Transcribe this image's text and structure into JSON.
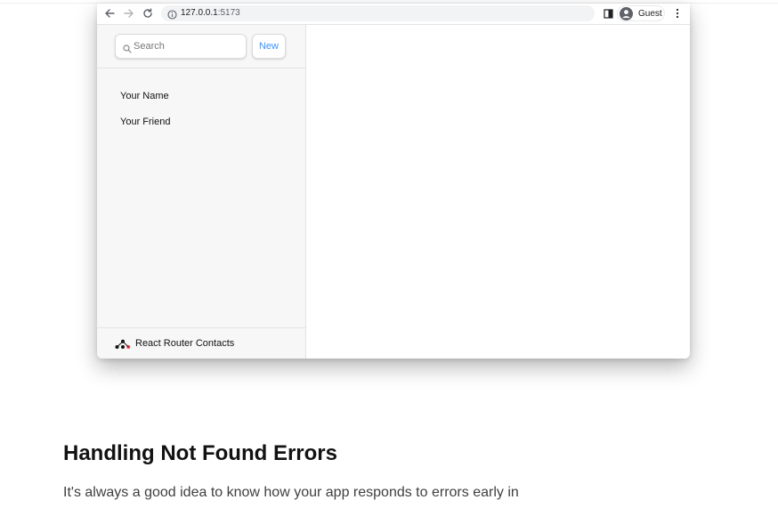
{
  "browser": {
    "url_host": "127.0.0.1",
    "url_port": ":5173",
    "profile_label": "Guest",
    "icons": [
      "back-arrow-icon",
      "forward-arrow-icon",
      "reload-icon",
      "site-info-icon",
      "side-panel-icon",
      "profile-avatar-icon",
      "menu-kebab-icon"
    ]
  },
  "app": {
    "search": {
      "placeholder": "Search",
      "value": ""
    },
    "new_label": "New",
    "contacts": [
      "Your Name",
      "Your Friend"
    ],
    "footer_brand": "React Router Contacts",
    "colors": {
      "accent": "#3992ff",
      "logo_red": "#f44250",
      "sidebar_bg": "#f7f7f7"
    }
  },
  "article": {
    "heading": "Handling Not Found Errors",
    "paragraph": "It's always a good idea to know how your app responds to errors early in"
  }
}
